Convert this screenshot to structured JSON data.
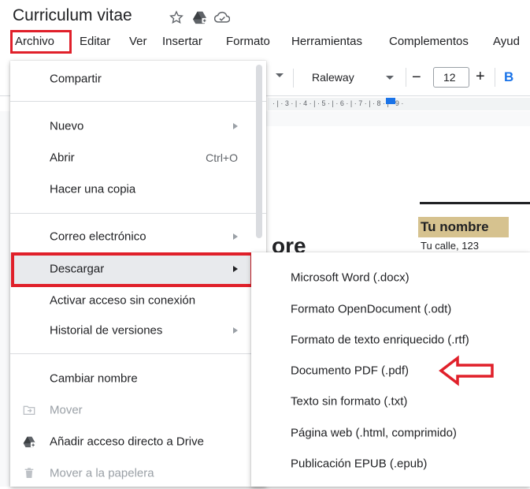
{
  "app": {
    "doc_title": "Curriculum vitae",
    "title_icons": [
      "star-icon",
      "drive-move-icon",
      "cloud-status-icon"
    ]
  },
  "menubar": {
    "items": [
      "Archivo",
      "Editar",
      "Ver",
      "Insertar",
      "Formato",
      "Herramientas",
      "Complementos",
      "Ayud"
    ]
  },
  "toolbar": {
    "font": "Raleway",
    "font_size": "12",
    "bold_label": "B",
    "minus": "−",
    "plus": "+"
  },
  "ruler": {
    "ticks": "· | · 3 · | · 4 · | · 5 · | · 6 · | · 7 · | · 8 · | · 9 ·"
  },
  "document": {
    "name_heading": "Tu nombre",
    "street": "Tu calle, 123",
    "partial_word": "ore"
  },
  "file_menu": {
    "items": [
      {
        "label": "Compartir"
      },
      {
        "label": "Nuevo",
        "has_submenu": true
      },
      {
        "label": "Abrir",
        "shortcut": "Ctrl+O"
      },
      {
        "label": "Hacer una copia"
      },
      {
        "label": "Correo electrónico",
        "has_submenu": true
      },
      {
        "label": "Descargar",
        "has_submenu": true,
        "active": true
      },
      {
        "label": "Activar acceso sin conexión"
      },
      {
        "label": "Historial de versiones",
        "has_submenu": true
      },
      {
        "label": "Cambiar nombre"
      },
      {
        "label": "Mover",
        "icon": "move-folder-icon",
        "disabled": true
      },
      {
        "label": "Añadir acceso directo a Drive",
        "icon": "drive-shortcut-icon"
      },
      {
        "label": "Mover a la papelera",
        "icon": "trash-icon",
        "disabled": true
      }
    ]
  },
  "download_submenu": {
    "items": [
      "Microsoft Word (.docx)",
      "Formato OpenDocument (.odt)",
      "Formato de texto enriquecido (.rtf)",
      "Documento PDF (.pdf)",
      "Texto sin formato (.txt)",
      "Página web (.html, comprimido)",
      "Publicación EPUB (.epub)"
    ]
  },
  "colors": {
    "highlight_red": "#e0202a",
    "active_bg": "#e8eaed",
    "bold_blue": "#1a73e8",
    "name_bg": "#d6c28f"
  }
}
